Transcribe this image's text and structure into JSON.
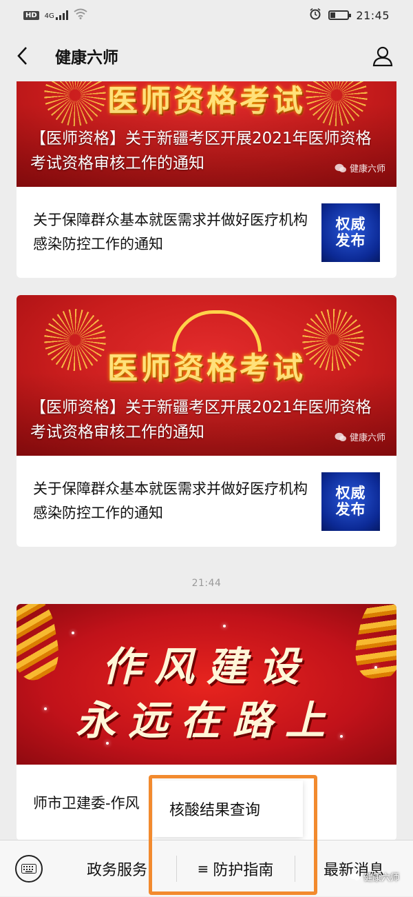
{
  "status_bar": {
    "network": "HD",
    "signal": "4G",
    "time": "21:45",
    "battery_level": 0.3
  },
  "nav": {
    "title": "健康六师",
    "back_icon": "chevron-left-icon",
    "profile_icon": "person-icon"
  },
  "feed": {
    "cards": [
      {
        "hero_art_text": "医师资格考试",
        "hero_caption": "【医师资格】关于新疆考区开展2021年医师资格考试资格审核工作的通知",
        "hero_source": "健康六师",
        "item_title": "关于保障群众基本就医需求并做好医疗机构感染防控工作的通知",
        "item_thumb_line1": "权威",
        "item_thumb_line2": "发布"
      },
      {
        "hero_art_text": "医师资格考试",
        "hero_caption": "【医师资格】关于新疆考区开展2021年医师资格考试资格审核工作的通知",
        "hero_source": "健康六师",
        "item_title": "关于保障群众基本就医需求并做好医疗机构感染防控工作的通知",
        "item_thumb_line1": "权威",
        "item_thumb_line2": "发布"
      }
    ],
    "time_separator": "21:44",
    "card3": {
      "hero_line1": "作风建设",
      "hero_line2": "永远在路上",
      "item_title": "师市卫建委-作风"
    }
  },
  "bottom_menu": {
    "keyboard_icon": "keyboard-icon",
    "items": [
      "政务服务",
      "防护指南",
      "最新消息"
    ],
    "active_prefix": "≡",
    "popup_item": "核酸结果查询"
  },
  "watermark": "健康六师",
  "colors": {
    "highlight": "#f28a2e",
    "thumb_blue": "#0c2a96",
    "hero_red": "#c91d1d"
  }
}
